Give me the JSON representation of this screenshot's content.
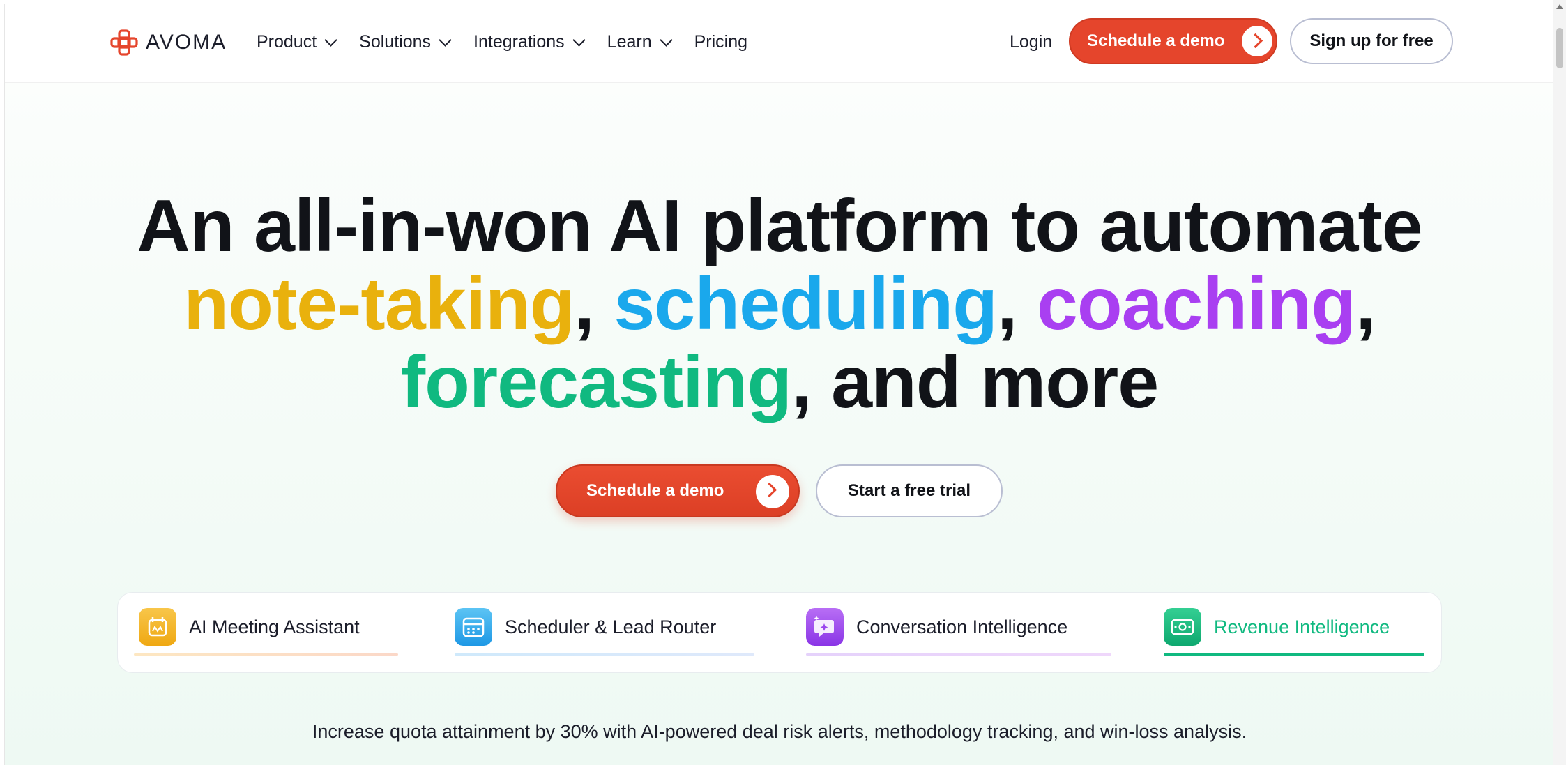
{
  "nav": {
    "logo_text": "AVOMA",
    "links": [
      {
        "label": "Product",
        "has_dropdown": true
      },
      {
        "label": "Solutions",
        "has_dropdown": true
      },
      {
        "label": "Integrations",
        "has_dropdown": true
      },
      {
        "label": "Learn",
        "has_dropdown": true
      },
      {
        "label": "Pricing",
        "has_dropdown": false
      }
    ],
    "login_label": "Login",
    "demo_label": "Schedule a demo",
    "signup_label": "Sign up for free"
  },
  "hero": {
    "line1": "An all-in-won AI platform to automate",
    "word_notetaking": "note-taking",
    "comma1": ", ",
    "word_scheduling": "scheduling",
    "comma2": ", ",
    "word_coaching": "coaching",
    "comma3": ",",
    "word_forecasting": "forecasting",
    "tail": ", and more",
    "demo_label": "Schedule a demo",
    "trial_label": "Start a free trial"
  },
  "tabs": [
    {
      "label": "AI Meeting Assistant",
      "icon": "meeting-assistant-icon",
      "color": "#f3b521",
      "active": false
    },
    {
      "label": "Scheduler & Lead Router",
      "icon": "calendar-icon",
      "color": "#1aa8ec",
      "active": false
    },
    {
      "label": "Conversation Intelligence",
      "icon": "conversation-icon",
      "color": "#a93ff1",
      "active": false
    },
    {
      "label": "Revenue Intelligence",
      "icon": "revenue-icon",
      "color": "#10b980",
      "active": true
    }
  ],
  "tagline": "Increase quota attainment by 30% with AI-powered deal risk alerts, methodology tracking, and win-loss analysis.",
  "colors": {
    "accent": "#e5452c",
    "yellow": "#e9b10d",
    "blue": "#1aa8ec",
    "purple": "#a93ff1",
    "green": "#10b980"
  }
}
